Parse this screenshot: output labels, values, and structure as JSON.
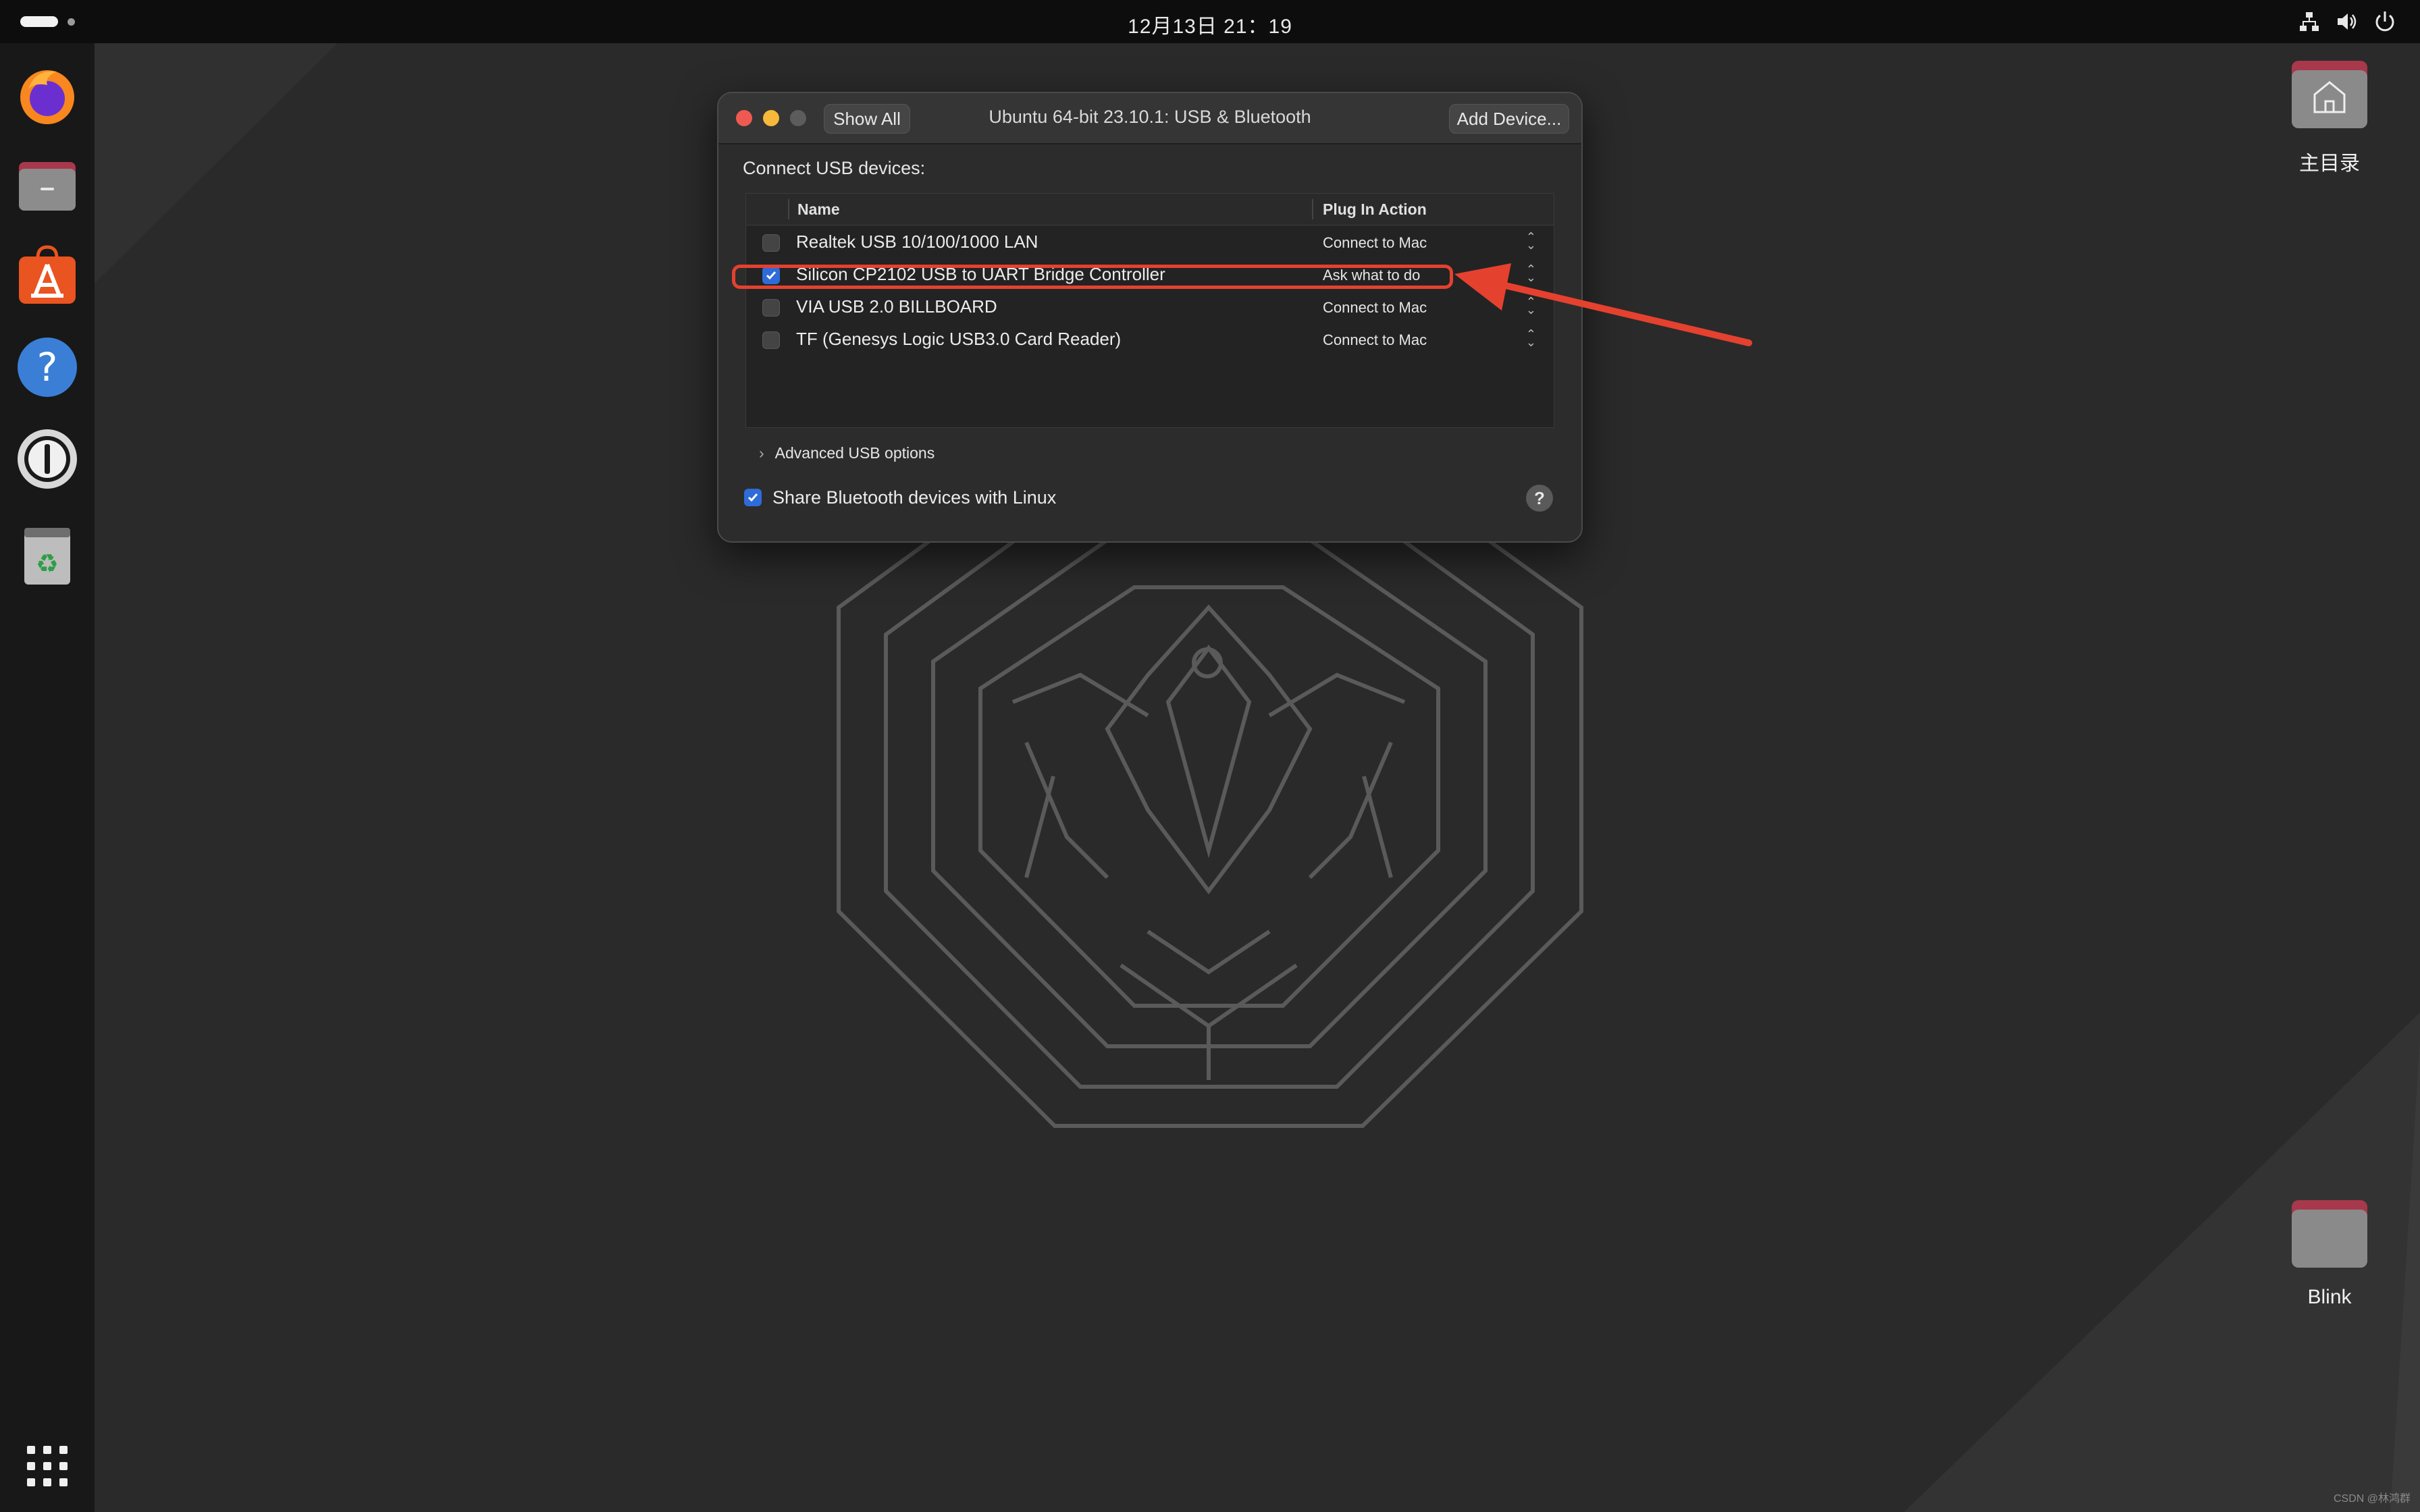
{
  "topbar": {
    "clock": "12月13日  21：19",
    "tray_icons": [
      "network-icon",
      "volume-icon",
      "power-icon"
    ]
  },
  "dock": {
    "apps": [
      {
        "name": "firefox-icon"
      },
      {
        "name": "files-icon"
      },
      {
        "name": "app-center-icon"
      },
      {
        "name": "help-icon"
      },
      {
        "name": "password-manager-icon"
      },
      {
        "name": "trash-icon"
      }
    ],
    "show_apps": "apps-grid-icon"
  },
  "desktop": {
    "icons": [
      {
        "label": "主目录",
        "icon": "home-folder-icon"
      },
      {
        "label": "Blink",
        "icon": "folder-icon"
      }
    ],
    "watermark": "CSDN @林鸿群"
  },
  "dialog": {
    "title": "Ubuntu 64-bit 23.10.1: USB & Bluetooth",
    "show_all": "Show All",
    "add_device": "Add Device...",
    "connect_label": "Connect USB devices:",
    "columns": {
      "name": "Name",
      "action": "Plug In Action"
    },
    "devices": [
      {
        "name": "Realtek USB 10/100/1000 LAN",
        "checked": false,
        "action": "Connect to Mac"
      },
      {
        "name": "Silicon CP2102 USB to UART Bridge Controller",
        "checked": true,
        "action": "Ask what to do"
      },
      {
        "name": "VIA USB 2.0 BILLBOARD",
        "checked": false,
        "action": "Connect to Mac"
      },
      {
        "name": "TF (Genesys Logic USB3.0 Card Reader)",
        "checked": false,
        "action": "Connect to Mac"
      }
    ],
    "advanced": "Advanced USB options",
    "share_bluetooth": "Share Bluetooth devices with Linux",
    "share_bluetooth_checked": true,
    "help": "?"
  },
  "colors": {
    "accent": "#2f6bd9",
    "annotation": "#e5412f"
  }
}
